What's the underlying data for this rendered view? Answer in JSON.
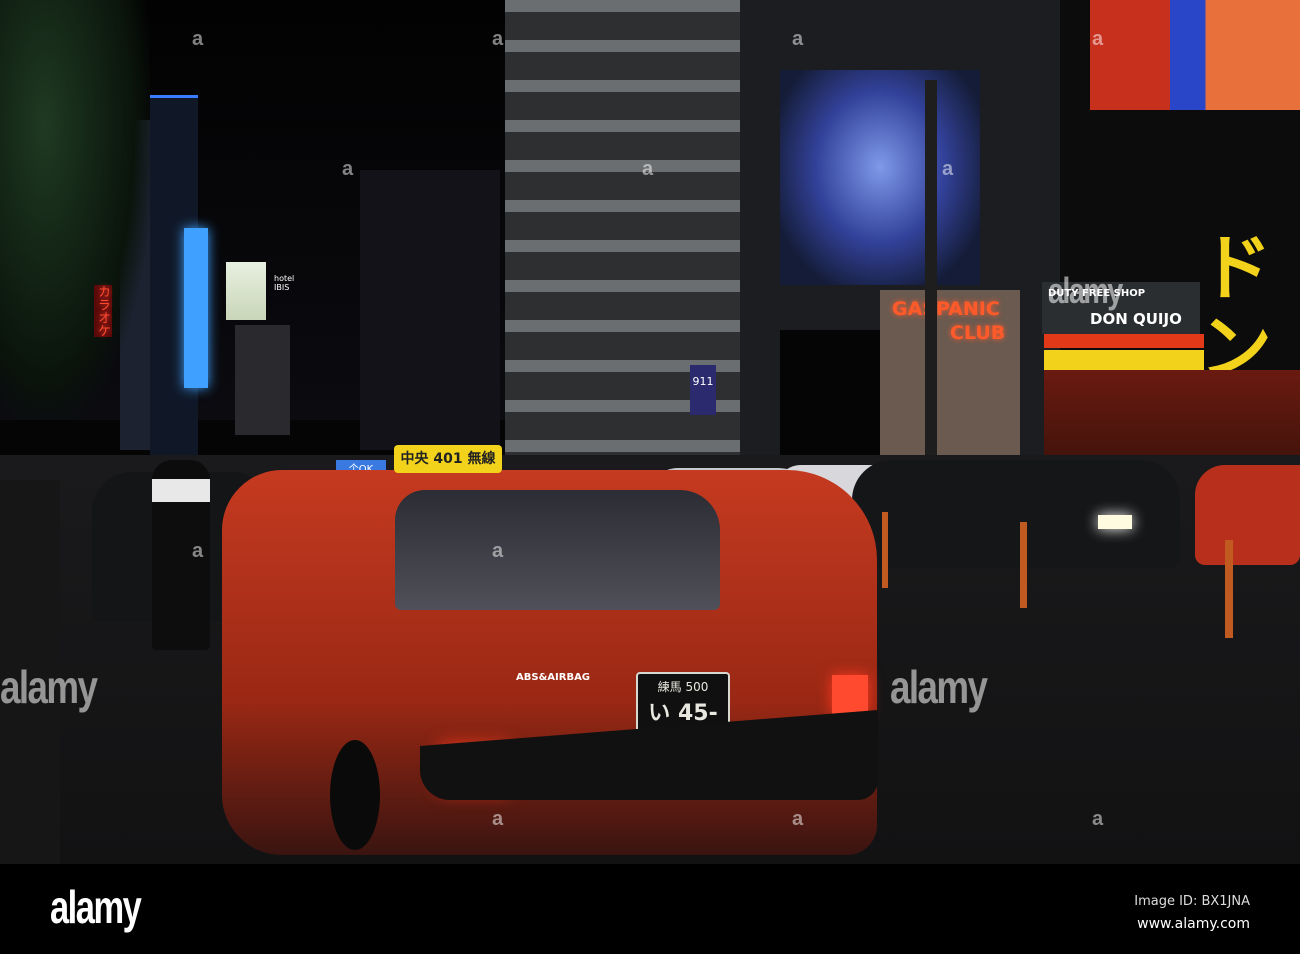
{
  "photo": {
    "taxi_roof_sign": "中央 401 無線",
    "plate_top": "練馬 500",
    "plate_bottom": "い 45-58",
    "rear_badge": "ABS&AIRBAG",
    "taxi_small_sign": "个OK",
    "club_sign_line1": "GASPANIC",
    "club_sign_line2": "CLUB",
    "duty_free": "DUTY FREE SHOP",
    "don_quijote": "DON QUIJO",
    "katakana_sign": "ドン",
    "karaoke_sign": "カラオケ",
    "hotel_sign": "hotel IBIS",
    "building_number": "911"
  },
  "watermark": {
    "text": "alamy",
    "small": "a"
  },
  "footer": {
    "logo": "alamy",
    "image_id": "Image ID: BX1JNA",
    "url": "www.alamy.com"
  },
  "colors": {
    "taxi": "#b8301c",
    "neon_blue": "#6fa0ff",
    "neon_orange": "#ff5a2a",
    "sign_yellow": "#f2d21a"
  }
}
